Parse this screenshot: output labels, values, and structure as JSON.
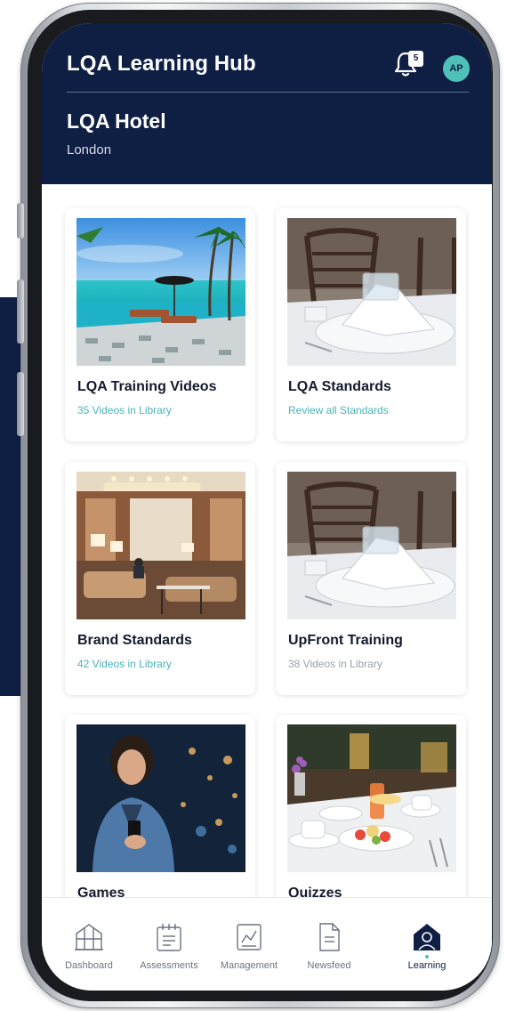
{
  "header": {
    "app_title": "LQA Learning Hub",
    "notification_count": "5",
    "avatar_initials": "AP",
    "hotel_name": "LQA Hotel",
    "hotel_city": "London"
  },
  "cards": [
    {
      "title": "LQA Training Videos",
      "subtitle": "35 Videos in Library",
      "image": "beach-resort-pool"
    },
    {
      "title": "LQA Standards",
      "subtitle": "Review all Standards",
      "image": "table-setting"
    },
    {
      "title": "Brand Standards",
      "subtitle": "42 Videos in Library",
      "image": "hotel-lobby"
    },
    {
      "title": "UpFront Training",
      "subtitle": "38 Videos in Library",
      "image": "table-setting"
    },
    {
      "title": "Games",
      "subtitle": "",
      "image": "woman-with-phone"
    },
    {
      "title": "Quizzes",
      "subtitle": "",
      "image": "breakfast-table"
    }
  ],
  "bottom_nav": [
    {
      "label": "Dashboard",
      "icon": "building-icon",
      "active": false
    },
    {
      "label": "Assessments",
      "icon": "calendar-icon",
      "active": false
    },
    {
      "label": "Management",
      "icon": "chart-icon",
      "active": false
    },
    {
      "label": "Newsfeed",
      "icon": "document-icon",
      "active": false
    },
    {
      "label": "Learning",
      "icon": "learning-icon",
      "active": true
    }
  ],
  "colors": {
    "navy": "#0f1f44",
    "teal_accent": "#4fc0b7",
    "subtitle_teal": "#4ab3b8",
    "muted_gray": "#9aa0a8"
  }
}
